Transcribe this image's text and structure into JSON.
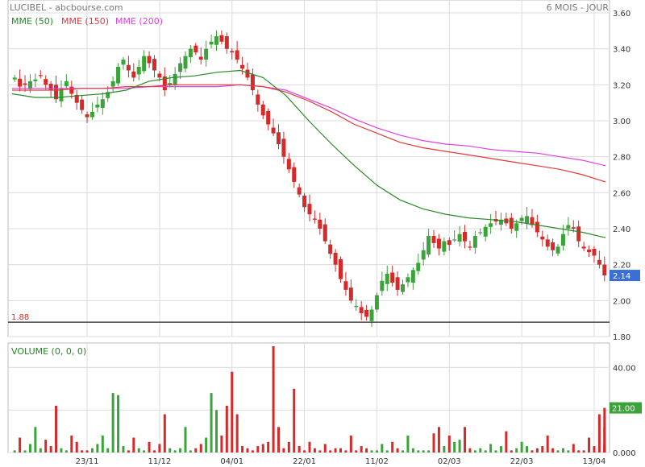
{
  "header": {
    "title": "LUCIBEL - abcbourse.com",
    "period": "6 MOIS - JOUR"
  },
  "colors": {
    "up": "#3aa33a",
    "down": "#d42a2a",
    "mme50": "#2a8a2a",
    "mme150": "#e23a3a",
    "mme200": "#e040e0",
    "support": "#222222",
    "grid": "#dcdcdc"
  },
  "chart_data": [
    {
      "type": "candlestick",
      "title": "",
      "legend": [
        {
          "name": "MME (50)",
          "color": "#2a8a2a"
        },
        {
          "name": "MME (150)",
          "color": "#e23a3a"
        },
        {
          "name": "MME (200)",
          "color": "#e040e0"
        }
      ],
      "ylim": [
        1.8,
        3.6
      ],
      "yticks": [
        "3.60",
        "3.40",
        "3.20",
        "3.00",
        "2.80",
        "2.60",
        "2.40",
        "2.20",
        "2.00",
        "1.80"
      ],
      "grid": true,
      "last_price_label": "2.14",
      "support": {
        "label": "1.88",
        "value": 1.88
      },
      "xticks": [
        {
          "label": "23/11",
          "index": 14
        },
        {
          "label": "11/12",
          "index": 28
        },
        {
          "label": "04/01",
          "index": 42
        },
        {
          "label": "22/01",
          "index": 56
        },
        {
          "label": "11/02",
          "index": 70
        },
        {
          "label": "02/03",
          "index": 84
        },
        {
          "label": "22/03",
          "index": 98
        },
        {
          "label": "13/04",
          "index": 112
        }
      ],
      "closes": [
        3.24,
        3.19,
        3.2,
        3.22,
        3.23,
        3.25,
        3.2,
        3.17,
        3.12,
        3.18,
        3.22,
        3.15,
        3.1,
        3.06,
        3.02,
        3.05,
        3.09,
        3.12,
        3.16,
        3.22,
        3.3,
        3.34,
        3.28,
        3.24,
        3.3,
        3.36,
        3.32,
        3.28,
        3.24,
        3.17,
        3.21,
        3.26,
        3.32,
        3.36,
        3.4,
        3.38,
        3.34,
        3.4,
        3.44,
        3.47,
        3.44,
        3.4,
        3.38,
        3.34,
        3.29,
        3.24,
        3.17,
        3.09,
        3.03,
        2.98,
        2.93,
        2.87,
        2.8,
        2.73,
        2.66,
        2.59,
        2.52,
        2.48,
        2.45,
        2.4,
        2.33,
        2.26,
        2.2,
        2.12,
        2.06,
        2.0,
        1.97,
        1.93,
        1.91,
        1.95,
        2.03,
        2.11,
        2.15,
        2.1,
        2.06,
        2.09,
        2.13,
        2.17,
        2.21,
        2.28,
        2.36,
        2.32,
        2.29,
        2.33,
        2.31,
        2.34,
        2.37,
        2.33,
        2.3,
        2.36,
        2.38,
        2.41,
        2.43,
        2.44,
        2.45,
        2.43,
        2.4,
        2.43,
        2.46,
        2.47,
        2.42,
        2.38,
        2.34,
        2.3,
        2.28,
        2.3,
        2.37,
        2.42,
        2.4,
        2.33,
        2.29,
        2.27,
        2.25,
        2.2,
        2.14
      ],
      "mme50": [
        3.15,
        3.13,
        3.13,
        3.14,
        3.15,
        3.17,
        3.22,
        3.24,
        3.25,
        3.27,
        3.28,
        3.24,
        3.14,
        3.0,
        2.87,
        2.75,
        2.64,
        2.56,
        2.51,
        2.48,
        2.46,
        2.45,
        2.44,
        2.42,
        2.4,
        2.38,
        2.35
      ],
      "mme150": [
        3.17,
        3.17,
        3.17,
        3.18,
        3.18,
        3.19,
        3.19,
        3.2,
        3.2,
        3.2,
        3.2,
        3.19,
        3.16,
        3.11,
        3.05,
        2.98,
        2.93,
        2.88,
        2.85,
        2.83,
        2.81,
        2.79,
        2.77,
        2.75,
        2.73,
        2.7,
        2.66
      ],
      "mme200": [
        3.18,
        3.18,
        3.18,
        3.18,
        3.18,
        3.18,
        3.19,
        3.19,
        3.19,
        3.19,
        3.2,
        3.19,
        3.17,
        3.12,
        3.07,
        3.01,
        2.96,
        2.92,
        2.89,
        2.87,
        2.86,
        2.84,
        2.83,
        2.82,
        2.8,
        2.78,
        2.75
      ]
    },
    {
      "type": "bar",
      "legend": "VOLUME (0, 0, 0)",
      "ylim": [
        0,
        50
      ],
      "yticks": [
        "40.00",
        "20.00",
        "0.000"
      ],
      "last_value_label": "21.00",
      "values": [
        1,
        7,
        1,
        4,
        12,
        2,
        6,
        3,
        22,
        2,
        1,
        8,
        5,
        1,
        1,
        2,
        4,
        8,
        2,
        28,
        27,
        3,
        1,
        7,
        2,
        1,
        5,
        1,
        4,
        18,
        2,
        1,
        2,
        12,
        1,
        2,
        4,
        7,
        28,
        20,
        8,
        22,
        38,
        18,
        3,
        2,
        1,
        3,
        4,
        5,
        50,
        12,
        2,
        5,
        30,
        3,
        1,
        5,
        2,
        1,
        4,
        1,
        2,
        2,
        1,
        8,
        1,
        3,
        2,
        1,
        1,
        4,
        1,
        5,
        2,
        1,
        8,
        2,
        1,
        1,
        1,
        9,
        12,
        3,
        8,
        5,
        6,
        12,
        2,
        1,
        2,
        1,
        4,
        1,
        3,
        10,
        1,
        2,
        5,
        3,
        1,
        2,
        3,
        8,
        2,
        1,
        2,
        1,
        4,
        1,
        1,
        7,
        3,
        18,
        12,
        2,
        4,
        3,
        21
      ]
    }
  ]
}
